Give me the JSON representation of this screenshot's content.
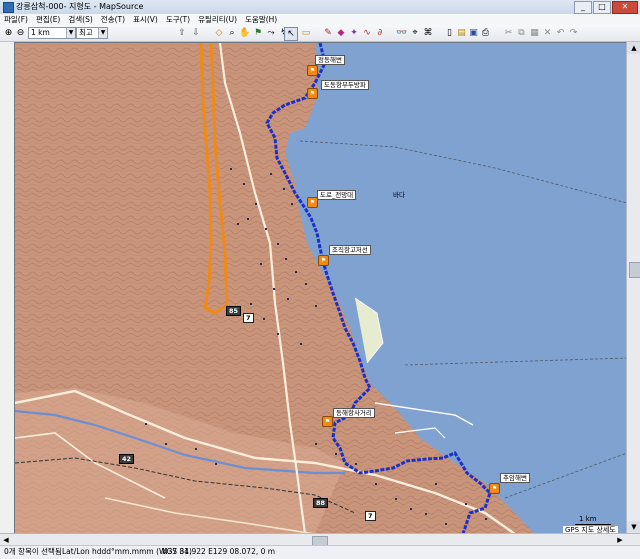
{
  "window": {
    "title": "강릉삼척-000- 지형도 - MapSource",
    "buttons": [
      "_",
      "□",
      "✕"
    ]
  },
  "menu": [
    "파일(F)",
    "편집(E)",
    "검색(S)",
    "전송(T)",
    "표시(V)",
    "도구(T)",
    "유틸리티(U)",
    "도움말(H)"
  ],
  "toolbar": {
    "scale_value": "1 km",
    "detail_value": "최고"
  },
  "map": {
    "colors": {
      "land": "#c9957a",
      "sea": "#7fa2d0",
      "track": "#1a30c8",
      "road_orange": "#f08a14"
    },
    "labels": [
      {
        "id": "l1",
        "text": "정동해변"
      },
      {
        "id": "l2",
        "text": "도동항부두방파"
      },
      {
        "id": "l3",
        "text": "도로_전망대"
      },
      {
        "id": "l4",
        "text": "바다"
      },
      {
        "id": "l5",
        "text": "조직항고저선"
      },
      {
        "id": "l6",
        "text": "동해항사거리"
      },
      {
        "id": "l7",
        "text": "추암해변"
      }
    ],
    "shields": [
      {
        "id": "s1",
        "text": "85",
        "style": "dark"
      },
      {
        "id": "s2",
        "text": "7",
        "style": "light"
      },
      {
        "id": "s3",
        "text": "42",
        "style": "dark"
      },
      {
        "id": "s4",
        "text": "88",
        "style": "dark"
      },
      {
        "id": "s5",
        "text": "7",
        "style": "light"
      }
    ],
    "scale": {
      "text": "1 km",
      "source": "GPS 지도 상세도"
    }
  },
  "status": {
    "selection": "0개 항목이 선택됨",
    "format": "Lat/Lon hddd°mm.mmm (WGS 84)",
    "coords": "N37 31.922 E129 08.072, 0 m"
  }
}
